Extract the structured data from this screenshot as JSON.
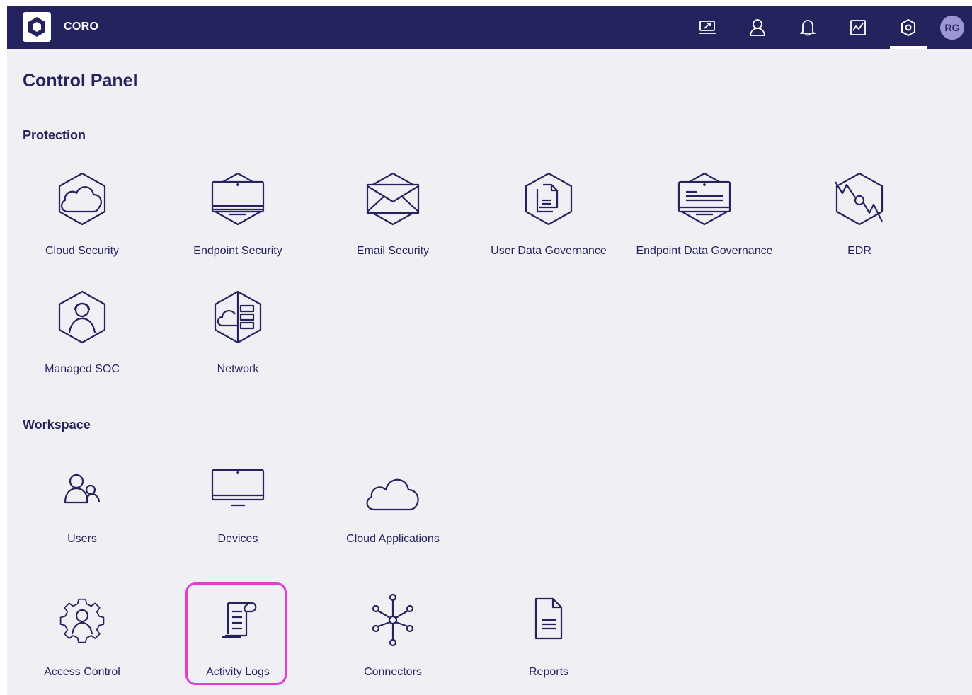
{
  "app": {
    "brand": "CORO",
    "avatar_initials": "RG",
    "accent": "#25235e",
    "highlight_color": "#e33bd5"
  },
  "topbar": {
    "icons": [
      "dashboard-icon",
      "user-icon",
      "bell-icon",
      "chart-icon",
      "settings-icon"
    ],
    "active": "settings-icon"
  },
  "page": {
    "title": "Control Panel"
  },
  "sections": {
    "protection": {
      "title": "Protection",
      "items": [
        {
          "label": "Cloud Security",
          "icon": "cloud-security-icon"
        },
        {
          "label": "Endpoint Security",
          "icon": "endpoint-security-icon"
        },
        {
          "label": "Email Security",
          "icon": "email-security-icon"
        },
        {
          "label": "User Data Governance",
          "icon": "user-data-governance-icon"
        },
        {
          "label": "Endpoint Data Governance",
          "icon": "endpoint-data-governance-icon"
        },
        {
          "label": "EDR",
          "icon": "edr-icon"
        },
        {
          "label": "Managed SOC",
          "icon": "managed-soc-icon"
        },
        {
          "label": "Network",
          "icon": "network-icon"
        }
      ]
    },
    "workspace": {
      "title": "Workspace",
      "items": [
        {
          "label": "Users",
          "icon": "users-icon"
        },
        {
          "label": "Devices",
          "icon": "devices-icon"
        },
        {
          "label": "Cloud Applications",
          "icon": "cloud-applications-icon"
        }
      ]
    },
    "other": {
      "items": [
        {
          "label": "Access Control",
          "icon": "access-control-icon"
        },
        {
          "label": "Activity Logs",
          "icon": "activity-logs-icon"
        },
        {
          "label": "Connectors",
          "icon": "connectors-icon"
        },
        {
          "label": "Reports",
          "icon": "reports-icon"
        }
      ]
    }
  }
}
